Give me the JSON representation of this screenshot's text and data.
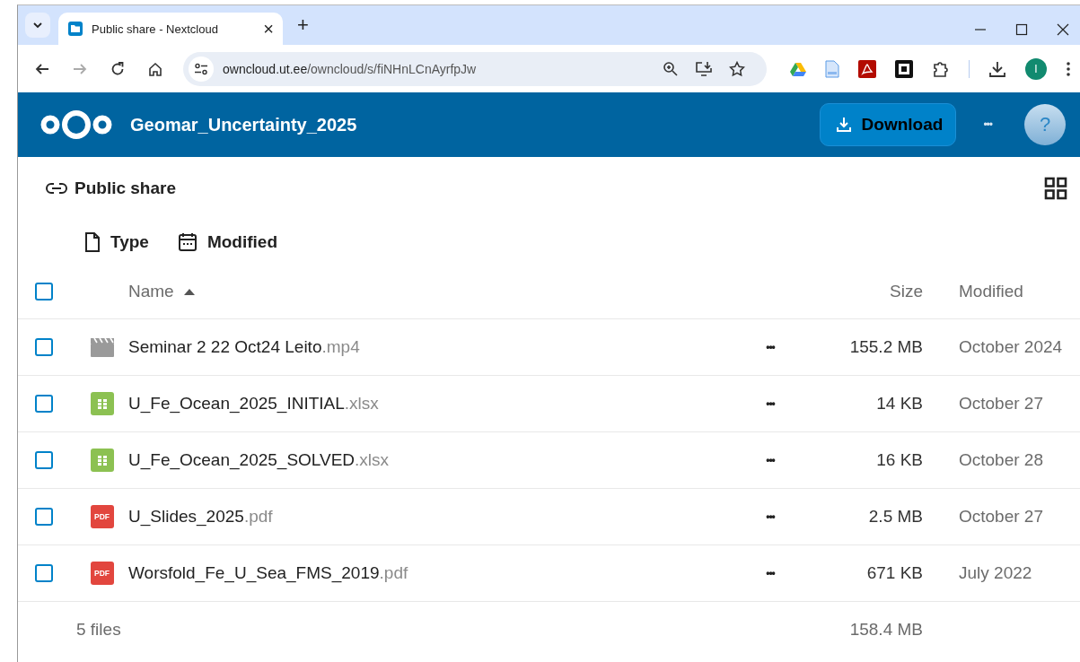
{
  "browser": {
    "tab": {
      "title": "Public share - Nextcloud",
      "close": "×"
    },
    "new_tab": "+",
    "url_host": "owncloud.ut.ee",
    "url_path": "/owncloud/s/fiNHnLCnAyrfpJw",
    "profile_initial": "I"
  },
  "header": {
    "title": "Geomar_Uncertainty_2025",
    "download": "Download",
    "more": "•••",
    "help": "?"
  },
  "share_label": "Public share",
  "filters": [
    {
      "kind": "type",
      "label": "Type"
    },
    {
      "kind": "modified",
      "label": "Modified"
    }
  ],
  "table": {
    "select_all": {
      "checked": false
    },
    "columns": {
      "name": "Name",
      "size": "Size",
      "modified": "Modified"
    },
    "rows": [
      {
        "kind": "video",
        "name": "Seminar 2 22 Oct24 Leito",
        "extension": ".mp4",
        "actions": "•••",
        "size": "155.2 MB",
        "modified": "October 2024",
        "checked": false
      },
      {
        "kind": "sheet",
        "name": "U_Fe_Ocean_2025_INITIAL",
        "extension": ".xlsx",
        "actions": "•••",
        "size": "14 KB",
        "modified": "October 27",
        "checked": false
      },
      {
        "kind": "sheet",
        "name": "U_Fe_Ocean_2025_SOLVED",
        "extension": ".xlsx",
        "actions": "•••",
        "size": "16 KB",
        "modified": "October 28",
        "checked": false
      },
      {
        "kind": "pdf",
        "icon_label": "PDF",
        "name": "U_Slides_2025",
        "extension": ".pdf",
        "actions": "•••",
        "size": "2.5 MB",
        "modified": "October 27",
        "checked": false
      },
      {
        "kind": "pdf",
        "icon_label": "PDF",
        "name": "Worsfold_Fe_U_Sea_FMS_2019",
        "extension": ".pdf",
        "actions": "•••",
        "size": "671 KB",
        "modified": "July 2022",
        "checked": false
      }
    ],
    "footer": {
      "count": "5 files",
      "total": "158.4 MB"
    }
  }
}
